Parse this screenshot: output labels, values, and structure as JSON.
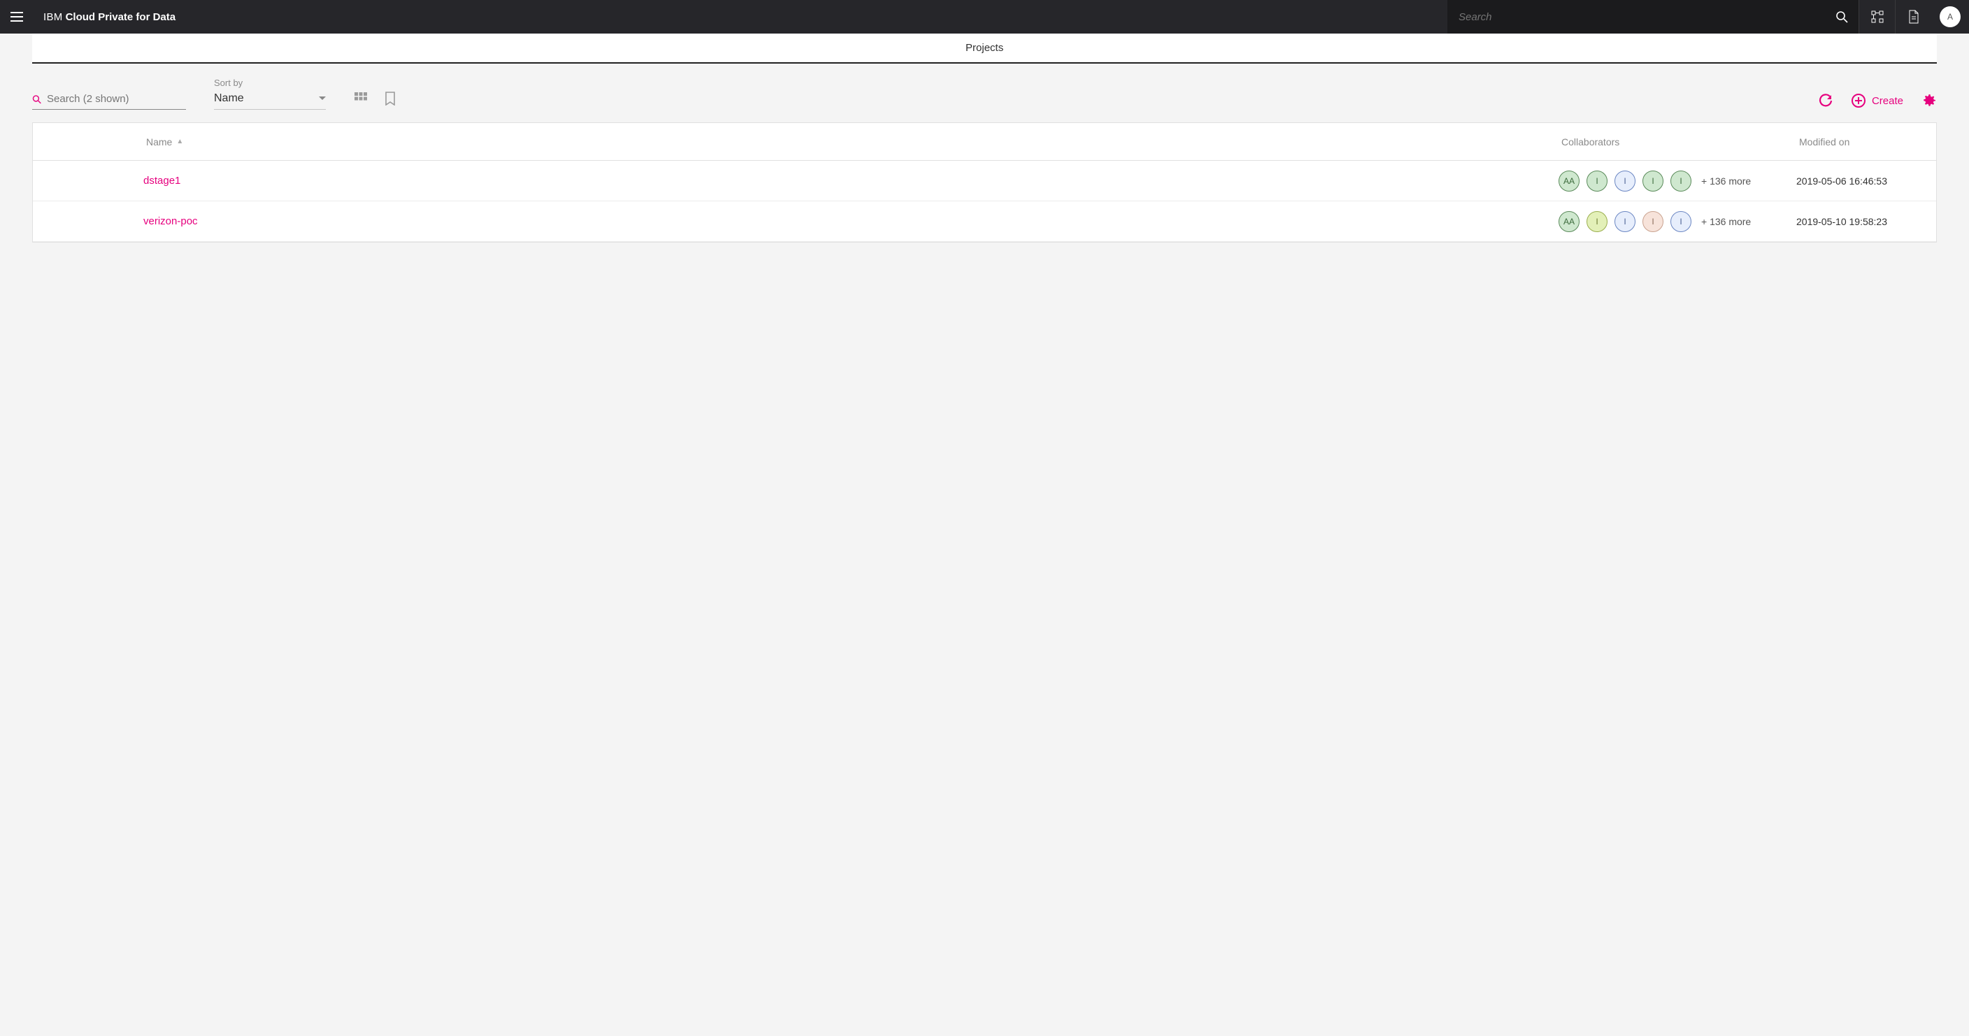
{
  "header": {
    "brand_prefix": "IBM",
    "brand_product": "Cloud Private for Data",
    "search_placeholder": "Search",
    "avatar_initial": "A"
  },
  "tabs": {
    "projects": "Projects"
  },
  "toolbar": {
    "search_placeholder": "Search (2 shown)",
    "sort_label": "Sort by",
    "sort_value": "Name",
    "create_label": "Create"
  },
  "table": {
    "columns": {
      "name": "Name",
      "collaborators": "Collaborators",
      "modified": "Modified on"
    },
    "rows": [
      {
        "name": "dstage1",
        "more_text": "+ 136 more",
        "modified": "2019-05-06 16:46:53",
        "avatars": [
          {
            "label": "AA",
            "bg": "#cfe8cf",
            "border": "#5a8a5a",
            "fg": "#3b6a3b"
          },
          {
            "label": "I",
            "bg": "#cfe8cf",
            "border": "#5a8a5a",
            "fg": "#3b6a3b"
          },
          {
            "label": "I",
            "bg": "#e7eefc",
            "border": "#6a86c2",
            "fg": "#4a5f92"
          },
          {
            "label": "I",
            "bg": "#cfe8cf",
            "border": "#5a8a5a",
            "fg": "#3b6a3b"
          },
          {
            "label": "I",
            "bg": "#cfe8cf",
            "border": "#5a8a5a",
            "fg": "#3b6a3b"
          }
        ]
      },
      {
        "name": "verizon-poc",
        "more_text": "+ 136 more",
        "modified": "2019-05-10 19:58:23",
        "avatars": [
          {
            "label": "AA",
            "bg": "#cfe8cf",
            "border": "#5a8a5a",
            "fg": "#3b6a3b"
          },
          {
            "label": "I",
            "bg": "#e3f0b8",
            "border": "#9aae4e",
            "fg": "#6a7a2e"
          },
          {
            "label": "I",
            "bg": "#e7eefc",
            "border": "#6a86c2",
            "fg": "#4a5f92"
          },
          {
            "label": "I",
            "bg": "#f7e3da",
            "border": "#c9a28f",
            "fg": "#8a6a58"
          },
          {
            "label": "I",
            "bg": "#e7eefc",
            "border": "#6a86c2",
            "fg": "#4a5f92"
          }
        ]
      }
    ]
  },
  "colors": {
    "accent": "#e6007e"
  }
}
